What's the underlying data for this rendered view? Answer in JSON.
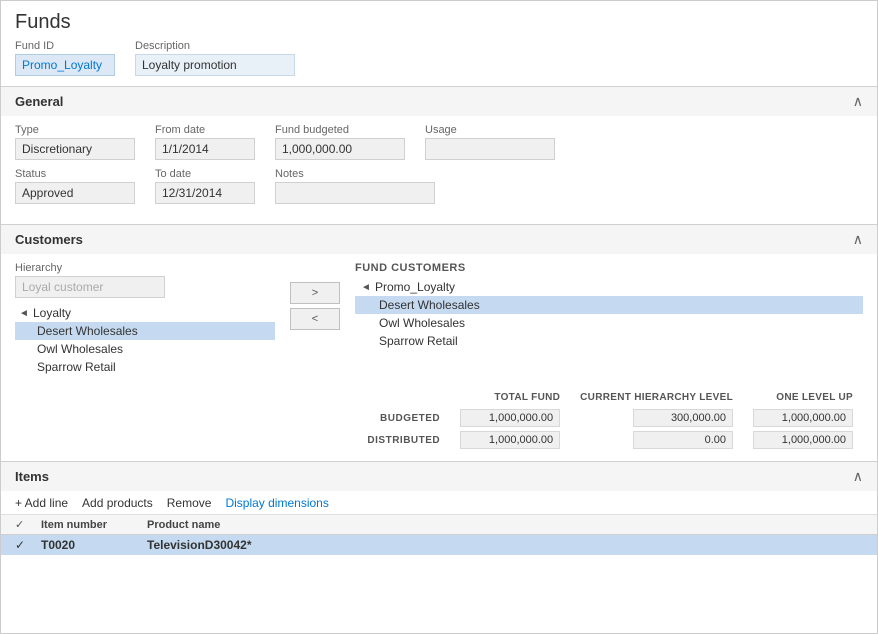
{
  "page": {
    "title": "Funds"
  },
  "fund_header": {
    "fund_id_label": "Fund ID",
    "description_label": "Description",
    "fund_id_value": "Promo_Loyalty",
    "description_value": "Loyalty promotion"
  },
  "general_section": {
    "title": "General",
    "toggle": "∧",
    "type_label": "Type",
    "type_value": "Discretionary",
    "from_date_label": "From date",
    "from_date_value": "1/1/2014",
    "fund_budgeted_label": "Fund budgeted",
    "fund_budgeted_value": "1,000,000.00",
    "usage_label": "Usage",
    "usage_value": "",
    "status_label": "Status",
    "status_value": "Approved",
    "to_date_label": "To date",
    "to_date_value": "12/31/2014",
    "notes_label": "Notes",
    "notes_value": ""
  },
  "customers_section": {
    "title": "Customers",
    "toggle": "∧",
    "hierarchy_label": "Hierarchy",
    "hierarchy_placeholder": "Loyal customer",
    "arrow_right": ">",
    "arrow_left": "<",
    "left_tree": [
      {
        "label": "Loyalty",
        "type": "parent",
        "expand": "◄"
      },
      {
        "label": "Desert Wholesales",
        "type": "child",
        "selected": true
      },
      {
        "label": "Owl Wholesales",
        "type": "child",
        "selected": false
      },
      {
        "label": "Sparrow Retail",
        "type": "child",
        "selected": false
      }
    ],
    "fund_customers_label": "FUND CUSTOMERS",
    "right_tree": [
      {
        "label": "Promo_Loyalty",
        "type": "parent",
        "expand": "◄"
      },
      {
        "label": "Desert Wholesales",
        "type": "child",
        "selected": true
      },
      {
        "label": "Owl Wholesales",
        "type": "child",
        "selected": false
      },
      {
        "label": "Sparrow Retail",
        "type": "child",
        "selected": false
      }
    ]
  },
  "summary": {
    "col_total_fund": "TOTAL FUND",
    "col_current_hierarchy": "CURRENT HIERARCHY LEVEL",
    "col_one_level_up": "ONE LEVEL UP",
    "row_budgeted": "BUDGETED",
    "row_distributed": "DISTRIBUTED",
    "total_fund_budgeted": "1,000,000.00",
    "total_fund_distributed": "1,000,000.00",
    "current_hier_budgeted": "300,000.00",
    "current_hier_distributed": "0.00",
    "one_level_budgeted": "1,000,000.00",
    "one_level_distributed": "1,000,000.00"
  },
  "items_section": {
    "title": "Items",
    "toggle": "∧",
    "toolbar": {
      "add_line": "+ Add line",
      "add_products": "Add products",
      "remove": "Remove",
      "display_dimensions": "Display dimensions"
    },
    "columns": {
      "check": "✓",
      "item_number": "Item number",
      "product_name": "Product name"
    },
    "rows": [
      {
        "item_number": "T0020",
        "product_name": "TelevisionD30042*",
        "selected": true
      }
    ]
  }
}
